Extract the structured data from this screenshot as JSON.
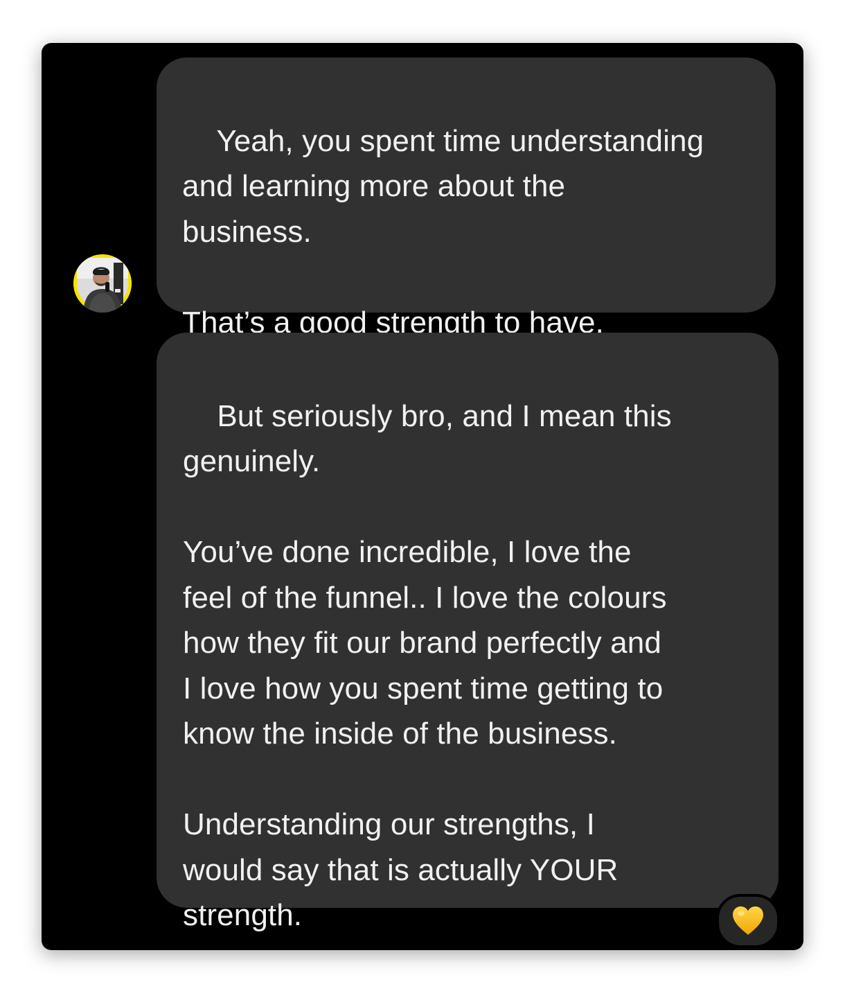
{
  "conversation": {
    "messages": [
      {
        "text": "Yeah, you spent time understanding\nand learning more about the\nbusiness.\n\nThat’s a good strength to have."
      },
      {
        "text": "But seriously bro, and I mean this\ngenuinely.\n\nYou’ve done incredible, I love the\nfeel of the funnel.. I love the colours\nhow they fit our brand perfectly and\nI love how you spent time getting to\nknow the inside of the business.\n\nUnderstanding our strengths, I\nwould say that is actually YOUR\nstrength.",
        "reaction": {
          "emoji": "yellow-heart-icon",
          "color": "#F5B800"
        }
      }
    ]
  },
  "theme": {
    "background": "#000000",
    "bubble": "#313131",
    "text": "#F1F1F1",
    "avatar_ring": "#F5E400"
  }
}
